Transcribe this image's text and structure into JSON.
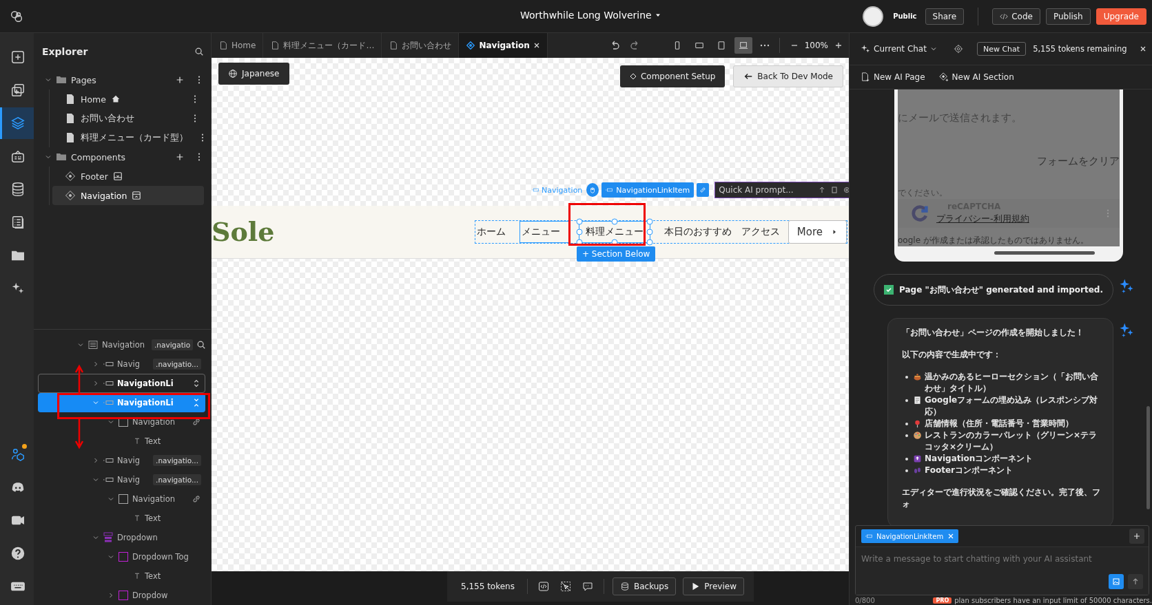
{
  "app_bar": {
    "project": "Worthwhile Long Wolverine",
    "visibility": "Public",
    "share": "Share",
    "code": "Code",
    "publish": "Publish",
    "upgrade": "Upgrade"
  },
  "rail": [
    {
      "kind": "add",
      "selected": false,
      "notify": false
    },
    {
      "kind": "add-page",
      "selected": false,
      "notify": false
    },
    {
      "kind": "layers",
      "selected": true,
      "notify": false
    },
    {
      "kind": "css",
      "selected": false,
      "notify": false
    },
    {
      "kind": "database",
      "selected": false,
      "notify": false
    },
    {
      "kind": "list",
      "selected": false,
      "notify": false
    },
    {
      "kind": "folder",
      "selected": false,
      "notify": false
    },
    {
      "kind": "sparkle",
      "selected": false,
      "notify": false
    }
  ],
  "rail_bottom": [
    {
      "kind": "team",
      "selected": false,
      "notify": true
    },
    {
      "kind": "discord",
      "selected": false,
      "notify": false
    },
    {
      "kind": "video",
      "selected": false,
      "notify": false
    },
    {
      "kind": "help",
      "selected": false,
      "notify": false
    },
    {
      "kind": "keyboard",
      "selected": false,
      "notify": false
    }
  ],
  "explorer": {
    "title": "Explorer",
    "folders": [
      {
        "label": "Pages",
        "expanded": true,
        "items": [
          {
            "label": "Home",
            "kind": "page",
            "home": true,
            "selected": false
          },
          {
            "label": "お問い合わせ",
            "kind": "page",
            "home": false,
            "selected": false
          },
          {
            "label": "料理メニュー（カード型）",
            "kind": "page",
            "home": false,
            "selected": false
          }
        ]
      },
      {
        "label": "Components",
        "expanded": true,
        "items": [
          {
            "label": "Footer",
            "kind": "footer",
            "home": false,
            "selected": false
          },
          {
            "label": "Navigation",
            "kind": "header",
            "home": false,
            "selected": true
          }
        ]
      }
    ]
  },
  "layers": [
    {
      "label": "Navigation",
      "kind": "list",
      "tag": ".navigatio",
      "expanded": true,
      "selected": false,
      "hovered": false,
      "children": [
        {
          "label": "Navig",
          "kind": "link-item",
          "tag": ".navigatio...",
          "expanded": false,
          "selected": false,
          "hovered": false
        },
        {
          "label": "NavigationLi",
          "kind": "link-item",
          "expanded": false,
          "selected": false,
          "hovered": true
        },
        {
          "label": "NavigationLi",
          "kind": "link-item",
          "expanded": true,
          "selected": true,
          "hovered": false,
          "children": [
            {
              "label": "Navigation",
              "kind": "box",
              "linked": true,
              "expanded": true,
              "selected": false,
              "hovered": false,
              "children": [
                {
                  "label": "Text",
                  "kind": "text",
                  "selected": false,
                  "hovered": false
                }
              ]
            }
          ]
        },
        {
          "label": "Navig",
          "kind": "link-item",
          "tag": ".navigatio...",
          "expanded": false,
          "selected": false,
          "hovered": false
        },
        {
          "label": "Navig",
          "kind": "link-item",
          "tag": ".navigatio...",
          "expanded": true,
          "selected": false,
          "hovered": false,
          "children": [
            {
              "label": "Navigation",
              "kind": "box",
              "linked": true,
              "expanded": true,
              "selected": false,
              "hovered": false,
              "children": [
                {
                  "label": "Text",
                  "kind": "text",
                  "selected": false,
                  "hovered": false
                }
              ]
            }
          ]
        },
        {
          "label": "Dropdown",
          "kind": "dropdown",
          "expanded": true,
          "selected": false,
          "hovered": false,
          "children": [
            {
              "label": "Dropdown Tog",
              "kind": "dropdown-box",
              "expanded": true,
              "selected": false,
              "hovered": false,
              "children": [
                {
                  "label": "Text",
                  "kind": "text",
                  "selected": false,
                  "hovered": false
                }
              ]
            },
            {
              "label": "Dropdow",
              "kind": "dropdown-box",
              "expanded": false,
              "selected": false,
              "hovered": false
            }
          ]
        }
      ]
    }
  ],
  "tabs": [
    {
      "label": "Home",
      "kind": "page",
      "selected": false
    },
    {
      "label": "料理メニュー（カード…",
      "kind": "page",
      "selected": false
    },
    {
      "label": "お問い合わせ",
      "kind": "page",
      "selected": false
    },
    {
      "label": "Navigation",
      "kind": "component",
      "selected": true
    }
  ],
  "toolbar": {
    "devices": [
      {
        "kind": "phone",
        "selected": false
      },
      {
        "kind": "tablet-landscape",
        "selected": false
      },
      {
        "kind": "tablet",
        "selected": false
      },
      {
        "kind": "desktop",
        "selected": true
      }
    ],
    "zoom": "100%"
  },
  "canvas": {
    "language": "Japanese",
    "component_setup": "Component Setup",
    "back": "Back To Dev Mode",
    "brand": "Sole",
    "links": [
      {
        "label": "ホーム",
        "selected": false,
        "hovered": false
      },
      {
        "label": "メニュー",
        "selected": false,
        "hovered": true
      },
      {
        "label": "料理メニュー",
        "selected": true,
        "hovered": false
      },
      {
        "label": "本日のおすすめ",
        "selected": false,
        "hovered": false
      },
      {
        "label": "アクセス",
        "selected": false,
        "hovered": false
      }
    ],
    "more": "More",
    "breadcrumb": "Navigation",
    "element_chip": "NavigationLinkItem",
    "prompt_placeholder": "Quick AI prompt...",
    "add_section": "+ Section Below"
  },
  "bottom_bar": {
    "tokens": "5,155 tokens",
    "backups": "Backups",
    "preview": "Preview"
  },
  "chat": {
    "current": "Current Chat",
    "new_chat": "New Chat",
    "tokens": "5,155 tokens remaining",
    "new_page": "New AI Page",
    "new_section": "New AI Section",
    "preview": {
      "line1": "にメールで送信されます。",
      "clear": "フォームをクリア",
      "line2": "でください。",
      "recaptcha": "reCAPTCHA",
      "terms": "プライバシー-利用規約",
      "disclaimer": "oogle が作成または承認したものではありません。"
    },
    "status": {
      "text": "Page \"お問い合わせ\" generated and imported.",
      "done": true
    },
    "message": {
      "lines": [
        "「お問い合わせ」ページの作成を開始しました！",
        "以下の内容で生成中です："
      ],
      "bullets": [
        {
          "kind": "pot",
          "text": "温かみのあるヒーローセクション（「お問い合わせ」タイトル）"
        },
        {
          "kind": "form",
          "text": "Googleフォームの埋め込み（レスポンシブ対応）"
        },
        {
          "kind": "pin",
          "text": "店舗情報（住所・電話番号・営業時間）"
        },
        {
          "kind": "palette",
          "text": "レストランのカラーパレット（グリーン×テラコッタ×クリーム）"
        },
        {
          "kind": "top",
          "text": "Navigationコンポーネント"
        },
        {
          "kind": "footprints",
          "text": "Footerコンポーネント"
        }
      ],
      "footer": "エディターで進行状況をご確認ください。完了後、フォ"
    },
    "context_chip": "NavigationLinkItem",
    "placeholder": "Write a message to start chatting with your AI assistant",
    "counter": "0/800",
    "plan_badge": "PRO",
    "plan_note": "plan subscribers have an input limit of 50000 characters."
  }
}
